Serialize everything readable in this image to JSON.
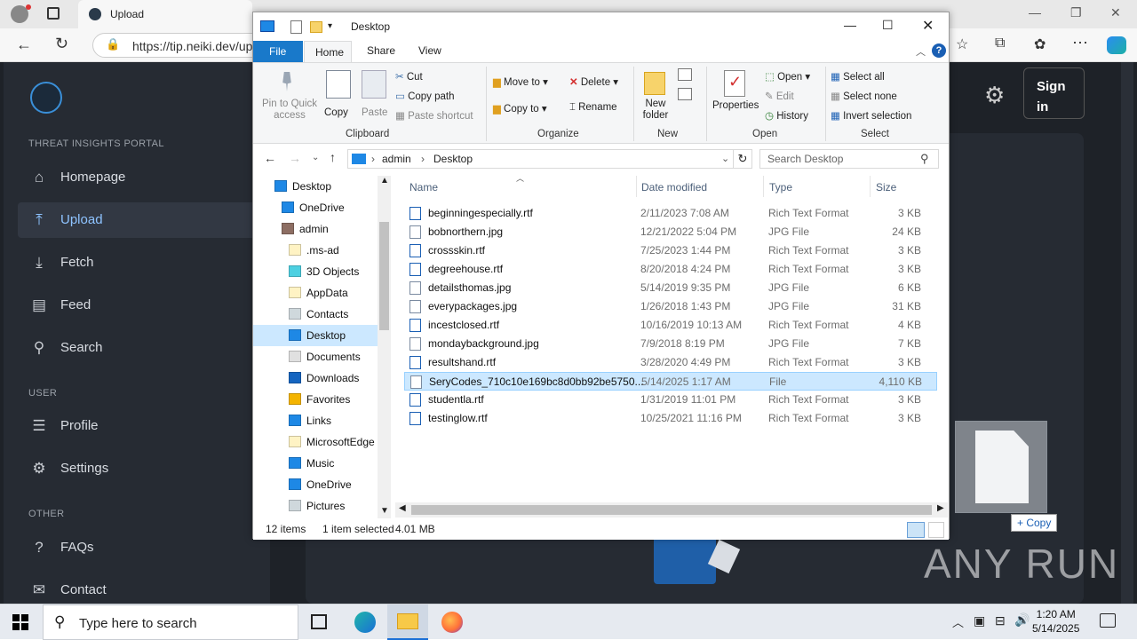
{
  "browser": {
    "tab_title": "Upload",
    "url": "https://tip.neiki.dev/up"
  },
  "site": {
    "portal_label": "THREAT INSIGHTS PORTAL",
    "nav": [
      {
        "label": "Homepage",
        "icon": "home-icon"
      },
      {
        "label": "Upload",
        "icon": "upload-icon",
        "active": true
      },
      {
        "label": "Fetch",
        "icon": "download-icon"
      },
      {
        "label": "Feed",
        "icon": "feed-icon"
      },
      {
        "label": "Search",
        "icon": "search-icon"
      }
    ],
    "user_section": "USER",
    "user_nav": [
      {
        "label": "Profile",
        "icon": "profile-icon"
      },
      {
        "label": "Settings",
        "icon": "gear-icon"
      }
    ],
    "other_section": "OTHER",
    "other_nav": [
      {
        "label": "FAQs",
        "icon": "faq-icon"
      },
      {
        "label": "Contact",
        "icon": "contact-icon"
      }
    ],
    "sign_in": "Sign in",
    "copy_tooltip": "+ Copy",
    "watermark": "ANY RUN"
  },
  "explorer": {
    "title": "Desktop",
    "tabs": [
      "File",
      "Home",
      "Share",
      "View"
    ],
    "active_tab": "Home",
    "ribbon": {
      "pin": "Pin to Quick access",
      "copy": "Copy",
      "paste": "Paste",
      "cut": "Cut",
      "copy_path": "Copy path",
      "paste_shortcut": "Paste shortcut",
      "clipboard": "Clipboard",
      "move_to": "Move to",
      "copy_to": "Copy to",
      "delete": "Delete",
      "rename": "Rename",
      "organize": "Organize",
      "new_folder": "New folder",
      "new": "New",
      "properties": "Properties",
      "open": "Open",
      "edit": "Edit",
      "history": "History",
      "open_group": "Open",
      "select_all": "Select all",
      "select_none": "Select none",
      "invert_selection": "Invert selection",
      "select_group": "Select"
    },
    "breadcrumb": [
      "admin",
      "Desktop"
    ],
    "search_placeholder": "Search Desktop",
    "tree": [
      "Desktop",
      "OneDrive",
      "admin",
      ".ms-ad",
      "3D Objects",
      "AppData",
      "Contacts",
      "Desktop",
      "Documents",
      "Downloads",
      "Favorites",
      "Links",
      "MicrosoftEdge",
      "Music",
      "OneDrive",
      "Pictures"
    ],
    "columns": [
      "Name",
      "Date modified",
      "Type",
      "Size"
    ],
    "files": [
      {
        "name": "beginningespecially.rtf",
        "date": "2/11/2023 7:08 AM",
        "type": "Rich Text Format",
        "size": "3 KB"
      },
      {
        "name": "bobnorthern.jpg",
        "date": "12/21/2022 5:04 PM",
        "type": "JPG File",
        "size": "24 KB"
      },
      {
        "name": "crossskin.rtf",
        "date": "7/25/2023 1:44 PM",
        "type": "Rich Text Format",
        "size": "3 KB"
      },
      {
        "name": "degreehouse.rtf",
        "date": "8/20/2018 4:24 PM",
        "type": "Rich Text Format",
        "size": "3 KB"
      },
      {
        "name": "detailsthomas.jpg",
        "date": "5/14/2019 9:35 PM",
        "type": "JPG File",
        "size": "6 KB"
      },
      {
        "name": "everypackages.jpg",
        "date": "1/26/2018 1:43 PM",
        "type": "JPG File",
        "size": "31 KB"
      },
      {
        "name": "incestclosed.rtf",
        "date": "10/16/2019 10:13 AM",
        "type": "Rich Text Format",
        "size": "4 KB"
      },
      {
        "name": "mondaybackground.jpg",
        "date": "7/9/2018 8:19 PM",
        "type": "JPG File",
        "size": "7 KB"
      },
      {
        "name": "resultshand.rtf",
        "date": "3/28/2020 4:49 PM",
        "type": "Rich Text Format",
        "size": "3 KB"
      },
      {
        "name": "SeryCodes_710c10e169bc8d0bb92be5750...",
        "date": "5/14/2025 1:17 AM",
        "type": "File",
        "size": "4,110 KB",
        "selected": true
      },
      {
        "name": "studentla.rtf",
        "date": "1/31/2019 11:01 PM",
        "type": "Rich Text Format",
        "size": "3 KB"
      },
      {
        "name": "testinglow.rtf",
        "date": "10/25/2021 11:16 PM",
        "type": "Rich Text Format",
        "size": "3 KB"
      }
    ],
    "status_items": "12 items",
    "status_selected": "1 item selected",
    "status_size": "4.01 MB"
  },
  "taskbar": {
    "search_placeholder": "Type here to search",
    "time": "1:20 AM",
    "date": "5/14/2025"
  }
}
